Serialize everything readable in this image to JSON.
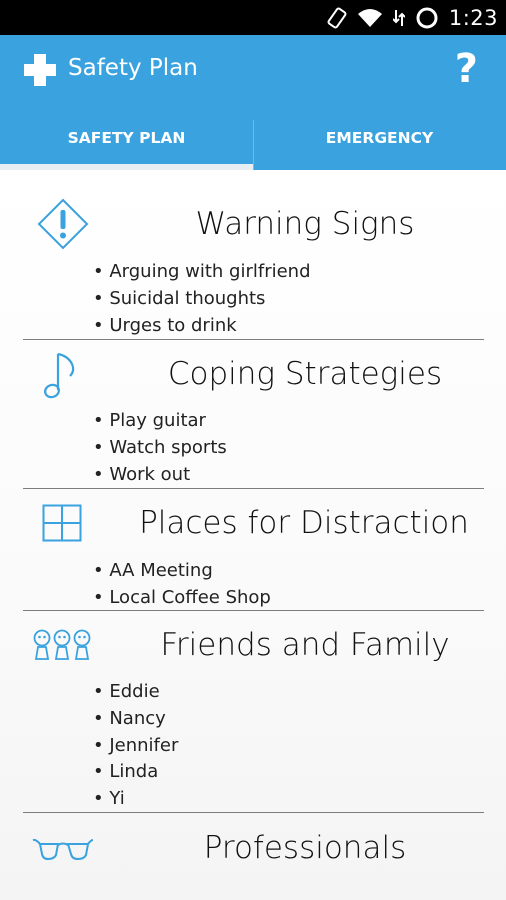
{
  "status_bar": {
    "time": "1:23",
    "icons": [
      "rotation-icon",
      "wifi-icon",
      "data-icon",
      "alarm-icon"
    ]
  },
  "app_bar": {
    "title": "Safety Plan",
    "logo_icon": "medical-cross-icon",
    "help_label": "?",
    "accent_color": "#39a2df"
  },
  "tabs": [
    {
      "label": "SAFETY PLAN",
      "selected": true
    },
    {
      "label": "EMERGENCY",
      "selected": false
    }
  ],
  "sections": [
    {
      "title": "Warning Signs",
      "icon": "warning-diamond-icon",
      "items": [
        "Arguing with girlfriend",
        "Suicidal thoughts",
        "Urges to drink"
      ]
    },
    {
      "title": "Coping Strategies",
      "icon": "music-note-icon",
      "items": [
        "Play guitar",
        "Watch sports",
        "Work out"
      ]
    },
    {
      "title": "Places for Distraction",
      "icon": "window-icon",
      "items": [
        "AA Meeting",
        "Local Coffee Shop"
      ]
    },
    {
      "title": "Friends and Family",
      "icon": "people-icon",
      "items": [
        "Eddie",
        "Nancy",
        "Jennifer",
        "Linda",
        "Yi"
      ]
    },
    {
      "title": "Professionals",
      "icon": "glasses-icon",
      "items": []
    }
  ]
}
